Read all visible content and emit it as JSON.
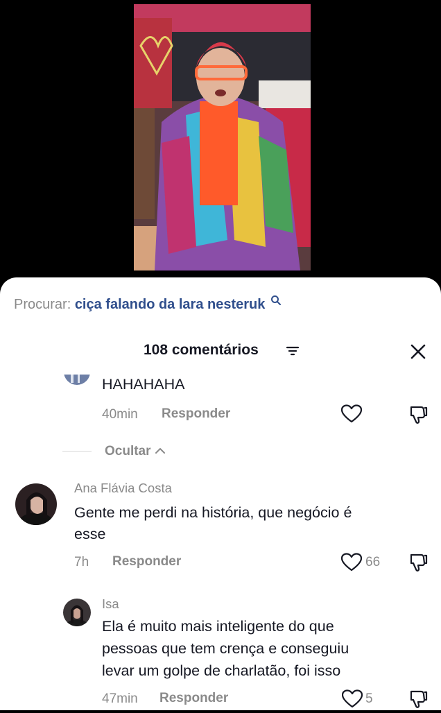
{
  "search": {
    "label": "Procurar:",
    "query": "ciça falando da lara nesteruk"
  },
  "comments_header": {
    "count_label": "108 comentários"
  },
  "replies_toggle": {
    "label": "Ocultar"
  },
  "comments": [
    {
      "text": "HAHAHAHA",
      "time": "40min",
      "reply_label": "Responder"
    },
    {
      "author": "Ana Flávia Costa",
      "text_line1": "Gente me perdi na história, que negócio é",
      "text_line2": "esse",
      "time": "7h",
      "reply_label": "Responder",
      "likes": "66"
    },
    {
      "author": "Isa",
      "text_line1": "Ela é muito mais inteligente do que",
      "text_line2": "pessoas que tem crença e conseguiu",
      "text_line3": "levar um golpe de charlatão, foi isso",
      "time": "47min",
      "reply_label": "Responder",
      "likes": "5"
    }
  ],
  "icons": {
    "search": "search-icon",
    "sort": "sort-icon",
    "close": "close-icon",
    "like": "heart-icon",
    "dislike": "thumbs-down-icon"
  },
  "colors": {
    "link_blue": "#2f4e8c",
    "meta_gray": "#8a8a8a",
    "text_dark": "#161823"
  }
}
